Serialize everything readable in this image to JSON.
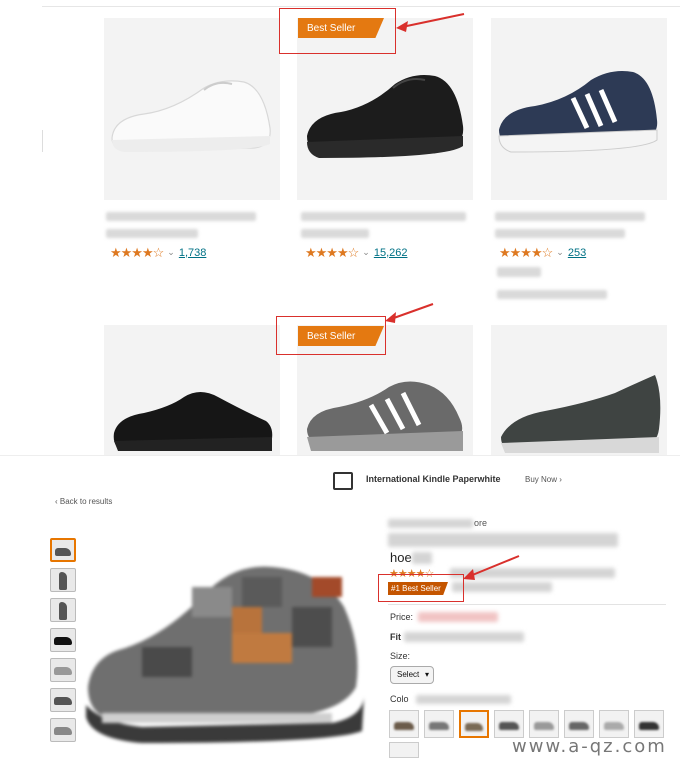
{
  "results": {
    "badge_label": "Best Seller",
    "cards": [
      {
        "stars": "★★★★☆",
        "count": "1,738"
      },
      {
        "stars": "★★★★☆",
        "count": "15,262"
      },
      {
        "stars": "★★★★☆",
        "count": "253"
      }
    ]
  },
  "detail": {
    "banner_text": "International Kindle Paperwhite",
    "banner_buy": "Buy Now ›",
    "back_link": "‹ Back to results",
    "best_seller_label": "#1 Best Seller",
    "price_label": "Price:",
    "size_label": "Size:",
    "size_select_value": "Select",
    "color_label": "Colo",
    "fit_label": "Fit",
    "title_tail": "hoe",
    "store_tail": "ore"
  },
  "watermark": "www.a-qz.com",
  "colors": {
    "badge": "#e47911",
    "best_seller": "#c45500",
    "highlight": "#d9302c",
    "link": "#007185",
    "star": "#de7921"
  }
}
